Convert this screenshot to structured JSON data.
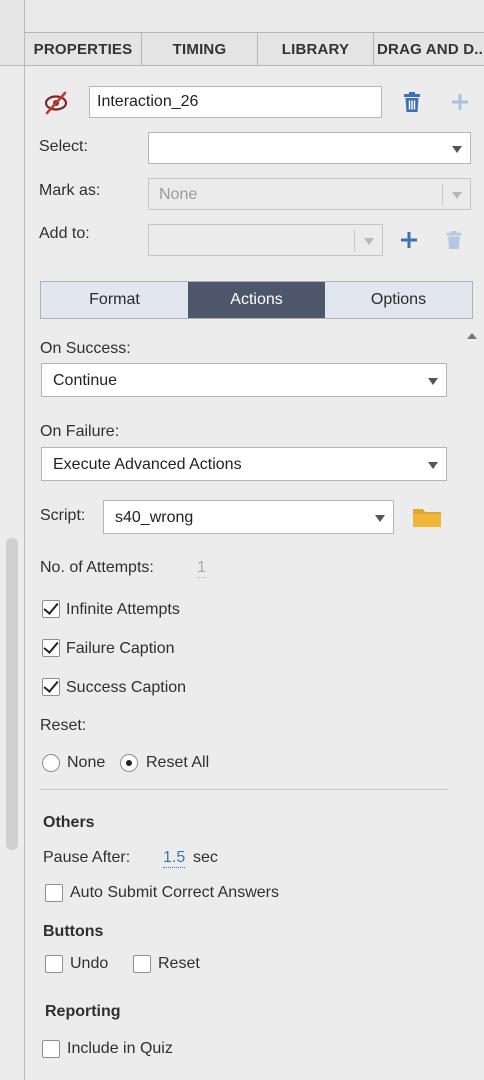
{
  "tabs": [
    {
      "label": "PROPERTIES"
    },
    {
      "label": "TIMING"
    },
    {
      "label": "LIBRARY"
    },
    {
      "label": "DRAG AND D..."
    }
  ],
  "header": {
    "name_value": "Interaction_26"
  },
  "fields": {
    "select_label": "Select:",
    "select_value": "",
    "mark_as_label": "Mark as:",
    "mark_as_value": "None",
    "add_to_label": "Add to:",
    "add_to_value": ""
  },
  "subtabs": [
    {
      "label": "Format"
    },
    {
      "label": "Actions"
    },
    {
      "label": "Options"
    }
  ],
  "actions": {
    "on_success_label": "On Success:",
    "on_success_value": "Continue",
    "on_failure_label": "On Failure:",
    "on_failure_value": "Execute Advanced Actions",
    "script_label": "Script:",
    "script_value": "s40_wrong",
    "attempts_label": "No. of Attempts:",
    "attempts_value": "1",
    "infinite_attempts": {
      "label": "Infinite Attempts",
      "checked": true
    },
    "failure_caption": {
      "label": "Failure Caption",
      "checked": true
    },
    "success_caption": {
      "label": "Success Caption",
      "checked": true
    },
    "reset_label": "Reset:",
    "reset_options": [
      {
        "label": "None",
        "selected": false
      },
      {
        "label": "Reset All",
        "selected": true
      }
    ]
  },
  "others": {
    "heading": "Others",
    "pause_after_label": "Pause After:",
    "pause_after_value": "1.5",
    "pause_after_unit": "sec",
    "auto_submit": {
      "label": "Auto Submit Correct Answers",
      "checked": false
    }
  },
  "buttons": {
    "heading": "Buttons",
    "undo": {
      "label": "Undo",
      "checked": false
    },
    "reset": {
      "label": "Reset",
      "checked": false
    }
  },
  "reporting": {
    "heading": "Reporting",
    "include_in_quiz": {
      "label": "Include in Quiz",
      "checked": false
    }
  },
  "icons": {
    "visibility": "eye-hidden-icon",
    "delete": "trash-icon",
    "add": "plus-icon",
    "folder": "folder-icon"
  },
  "colors": {
    "accent_blue": "#3b77b8",
    "active_tab": "#4e566c",
    "folder": "#e3a62c"
  }
}
